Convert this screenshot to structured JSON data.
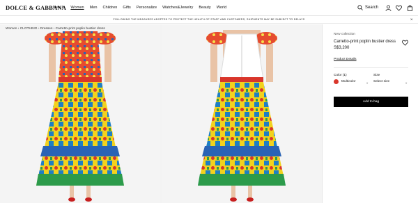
{
  "brand": {
    "logo": "DOLCE & GABBANA"
  },
  "nav": {
    "items": [
      "New In",
      "Women",
      "Men",
      "Children",
      "Gifts",
      "Personalize",
      "Watches&Jewelry",
      "Beauty",
      "World"
    ],
    "active_index": 1
  },
  "header_actions": {
    "search_label": "Search"
  },
  "notice": {
    "text": "FOLLOWING THE MEASURES ADOPTED TO PROTECT THE HEALTH OF STAFF AND CUSTOMERS, SHIPMENTS MAY BE SUBJECT TO DELAYS"
  },
  "breadcrumb": {
    "text": "Women › CLOTHING › Dresses › Carretto-print poplin bustier dress"
  },
  "product": {
    "collection": "New collection",
    "name": "Carretto-print poplin bustier dress",
    "price": "S$3,200",
    "details_link": "Product Details",
    "color_label": "Color (1)",
    "color_value": "Multicolor",
    "size_label": "Size",
    "size_value": "Select size",
    "add_to_bag": "Add to bag",
    "swatch_color": "#d9362b"
  },
  "colors": {
    "accent": "#000000",
    "background": "#f3f3f3"
  }
}
